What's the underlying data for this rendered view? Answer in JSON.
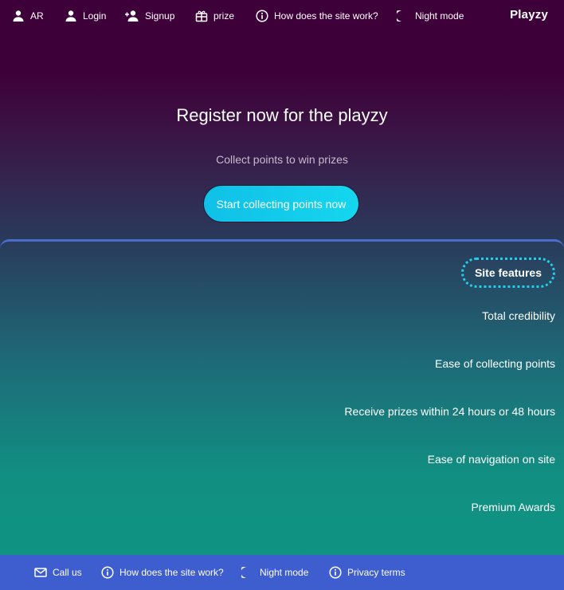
{
  "nav": {
    "lang_label": "AR",
    "login_label": "Login",
    "signup_label": "Signup",
    "prize_label": "prize",
    "how_label": "How does the site work?",
    "night_label": "Night mode",
    "brand": "Playzy"
  },
  "hero": {
    "title": "Register now for the playzy",
    "subtitle": "Collect points to win prizes",
    "cta_label": "Start collecting points now"
  },
  "features": {
    "heading": "Site features",
    "items": [
      "Total credibility",
      "Ease of collecting points",
      "Receive prizes within 24 hours or 48 hours",
      "Ease of navigation on site",
      "Premium Awards"
    ]
  },
  "footer": {
    "call_label": "Call us",
    "how_label": "How does the site work?",
    "night_label": "Night mode",
    "privacy_label": "Privacy terms"
  },
  "colors": {
    "header_bg": "#3e0038",
    "footer_bg": "#3e5ed0",
    "cta_bg": "#13c8ea",
    "accent_dotted": "#1fd0e8",
    "panel_border": "#4a6ed0"
  },
  "icons": {
    "lang": "person-icon",
    "login": "person-icon",
    "signup": "person-add-icon",
    "prize": "gift-icon",
    "how": "info-icon",
    "night": "moon-icon",
    "call": "mail-icon",
    "privacy": "info-icon"
  }
}
